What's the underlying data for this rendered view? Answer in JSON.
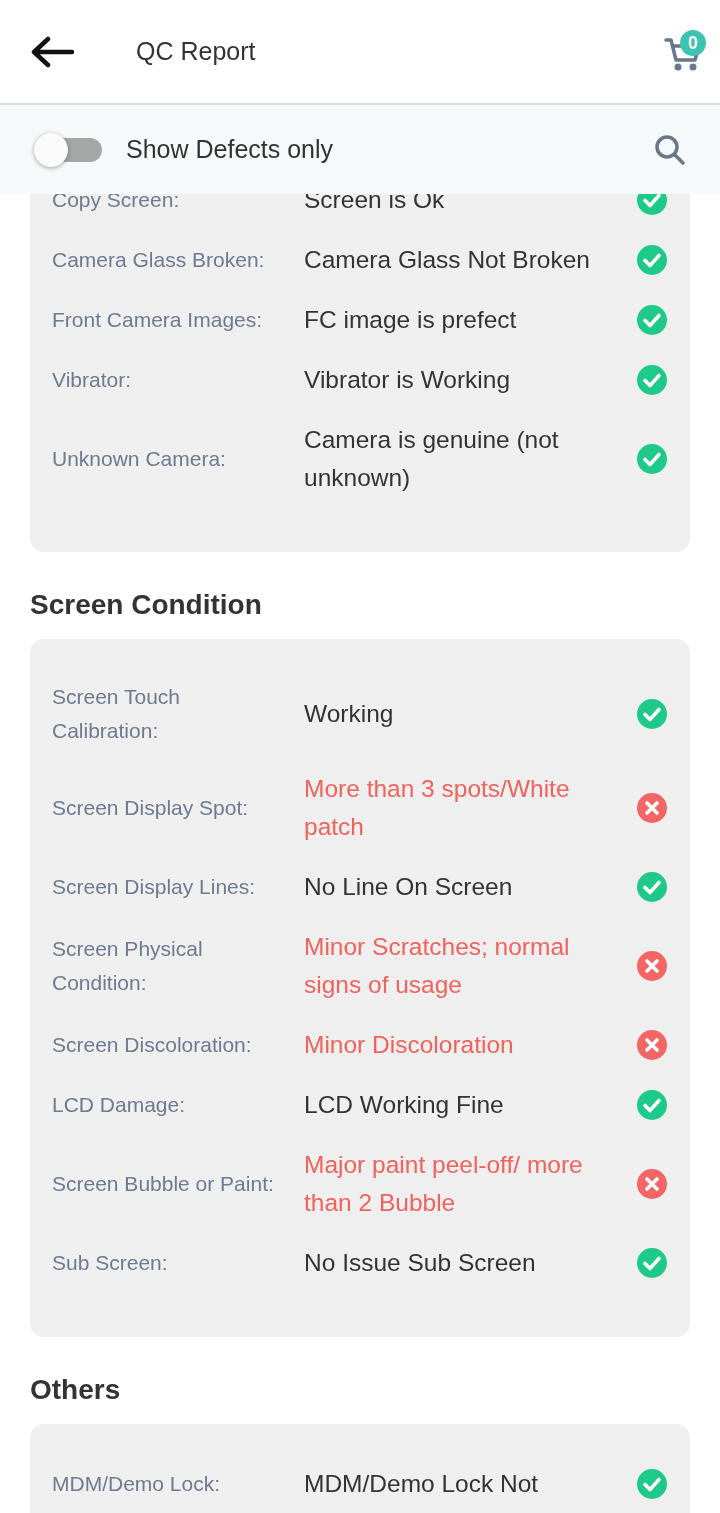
{
  "header": {
    "title": "QC Report",
    "cart_count": "0"
  },
  "filter": {
    "label": "Show Defects only",
    "on": false
  },
  "sections": [
    {
      "rows": [
        {
          "label": "Copy Screen:",
          "value": "Screen is Ok",
          "defect": false
        },
        {
          "label": "Camera Glass Broken:",
          "value": "Camera Glass Not Broken",
          "defect": false
        },
        {
          "label": "Front Camera Images:",
          "value": "FC image is prefect",
          "defect": false
        },
        {
          "label": "Vibrator:",
          "value": "Vibrator is Working",
          "defect": false
        },
        {
          "label": "Unknown Camera:",
          "value": "Camera is genuine (not unknown)",
          "defect": false
        }
      ]
    },
    {
      "title": "Screen Condition",
      "rows": [
        {
          "label": "Screen Touch Calibration:",
          "value": "Working",
          "defect": false
        },
        {
          "label": "Screen Display Spot:",
          "value": "More than 3 spots/White patch",
          "defect": true
        },
        {
          "label": "Screen Display Lines:",
          "value": "No Line On Screen",
          "defect": false
        },
        {
          "label": "Screen Physical Condition:",
          "value": "Minor Scratches; normal signs of usage",
          "defect": true
        },
        {
          "label": "Screen Discoloration:",
          "value": "Minor Discoloration",
          "defect": true
        },
        {
          "label": "LCD Damage:",
          "value": "LCD Working Fine",
          "defect": false
        },
        {
          "label": "Screen Bubble or Paint:",
          "value": "Major paint peel-off/ more than 2 Bubble",
          "defect": true
        },
        {
          "label": "Sub Screen:",
          "value": "No Issue Sub Screen",
          "defect": false
        }
      ]
    },
    {
      "title": "Others",
      "rows": [
        {
          "label": "MDM/Demo Lock:",
          "value": "MDM/Demo Lock Not",
          "defect": false
        }
      ]
    }
  ]
}
